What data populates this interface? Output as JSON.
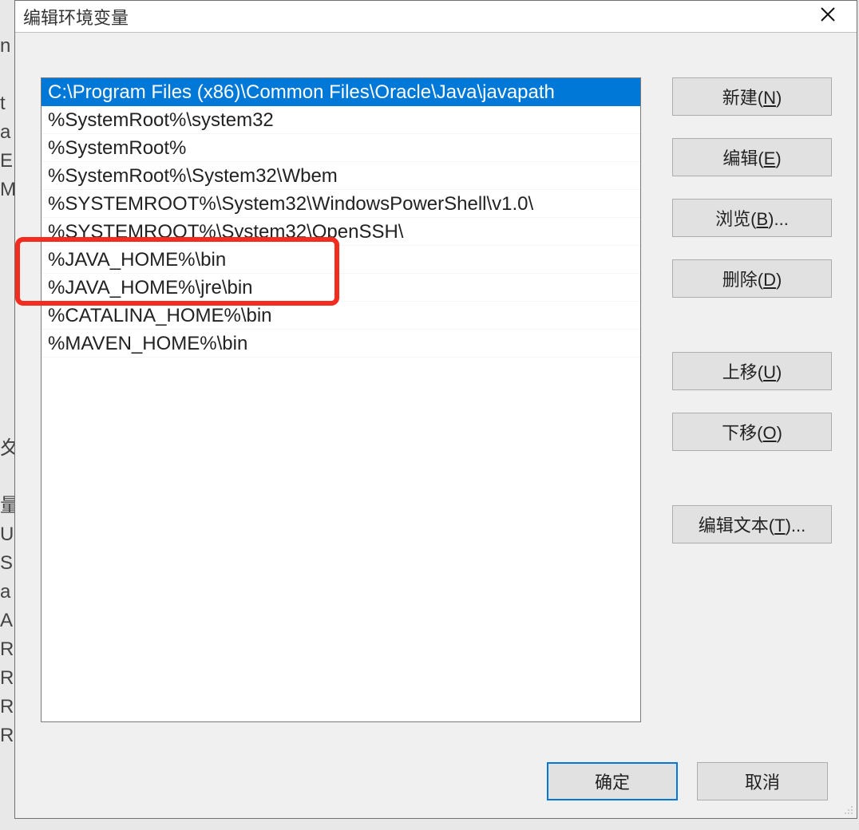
{
  "dialog": {
    "title": "编辑环境变量"
  },
  "list": {
    "items": [
      {
        "text": "C:\\Program Files (x86)\\Common Files\\Oracle\\Java\\javapath",
        "selected": true
      },
      {
        "text": "%SystemRoot%\\system32",
        "selected": false
      },
      {
        "text": "%SystemRoot%",
        "selected": false
      },
      {
        "text": "%SystemRoot%\\System32\\Wbem",
        "selected": false
      },
      {
        "text": "%SYSTEMROOT%\\System32\\WindowsPowerShell\\v1.0\\",
        "selected": false
      },
      {
        "text": "%SYSTEMROOT%\\System32\\OpenSSH\\",
        "selected": false
      },
      {
        "text": "%JAVA_HOME%\\bin",
        "selected": false
      },
      {
        "text": "%JAVA_HOME%\\jre\\bin",
        "selected": false
      },
      {
        "text": "%CATALINA_HOME%\\bin",
        "selected": false
      },
      {
        "text": "%MAVEN_HOME%\\bin",
        "selected": false
      }
    ]
  },
  "buttons": {
    "new": {
      "label": "新建",
      "accel": "N"
    },
    "edit": {
      "label": "编辑",
      "accel": "E"
    },
    "browse": {
      "label": "浏览",
      "accel": "B",
      "ellipsis": "..."
    },
    "delete": {
      "label": "删除",
      "accel": "D"
    },
    "moveup": {
      "label": "上移",
      "accel": "U"
    },
    "movedn": {
      "label": "下移",
      "accel": "O"
    },
    "edittxt": {
      "label": "编辑文本",
      "accel": "T",
      "ellipsis": "..."
    },
    "ok": {
      "label": "确定"
    },
    "cancel": {
      "label": "取消"
    }
  },
  "annotation": {
    "highlight_rows": [
      6,
      7
    ],
    "highlight_color": "#f22c1f"
  },
  "bg_artifacts": "n\n \nt\na\nE\nM\n\n\n\n\n\n\n\n\n夊\n \n量\nU\nS\na\nA\nR\nR\nR\nR"
}
